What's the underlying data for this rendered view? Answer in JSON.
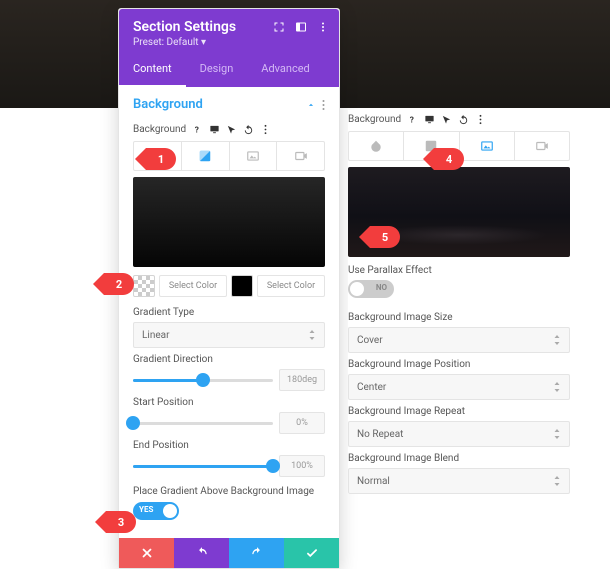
{
  "header": {
    "title": "Section Settings",
    "preset": "Preset: Default ▾"
  },
  "tabs": [
    "Content",
    "Design",
    "Advanced"
  ],
  "section_title": "Background",
  "bg_label": "Background",
  "select_color": "Select Color",
  "gradient": {
    "type_label": "Gradient Type",
    "type_value": "Linear",
    "direction_label": "Gradient Direction",
    "direction_value": "180deg",
    "direction_pct": 50,
    "start_label": "Start Position",
    "start_value": "0%",
    "start_pct": 0,
    "end_label": "End Position",
    "end_value": "100%",
    "end_pct": 100,
    "above_label": "Place Gradient Above Background Image",
    "above_value": "YES"
  },
  "image": {
    "parallax_label": "Use Parallax Effect",
    "parallax_value": "NO",
    "size_label": "Background Image Size",
    "size_value": "Cover",
    "pos_label": "Background Image Position",
    "pos_value": "Center",
    "repeat_label": "Background Image Repeat",
    "repeat_value": "No Repeat",
    "blend_label": "Background Image Blend",
    "blend_value": "Normal"
  },
  "markers": {
    "m1": "1",
    "m2": "2",
    "m3": "3",
    "m4": "4",
    "m5": "5"
  }
}
